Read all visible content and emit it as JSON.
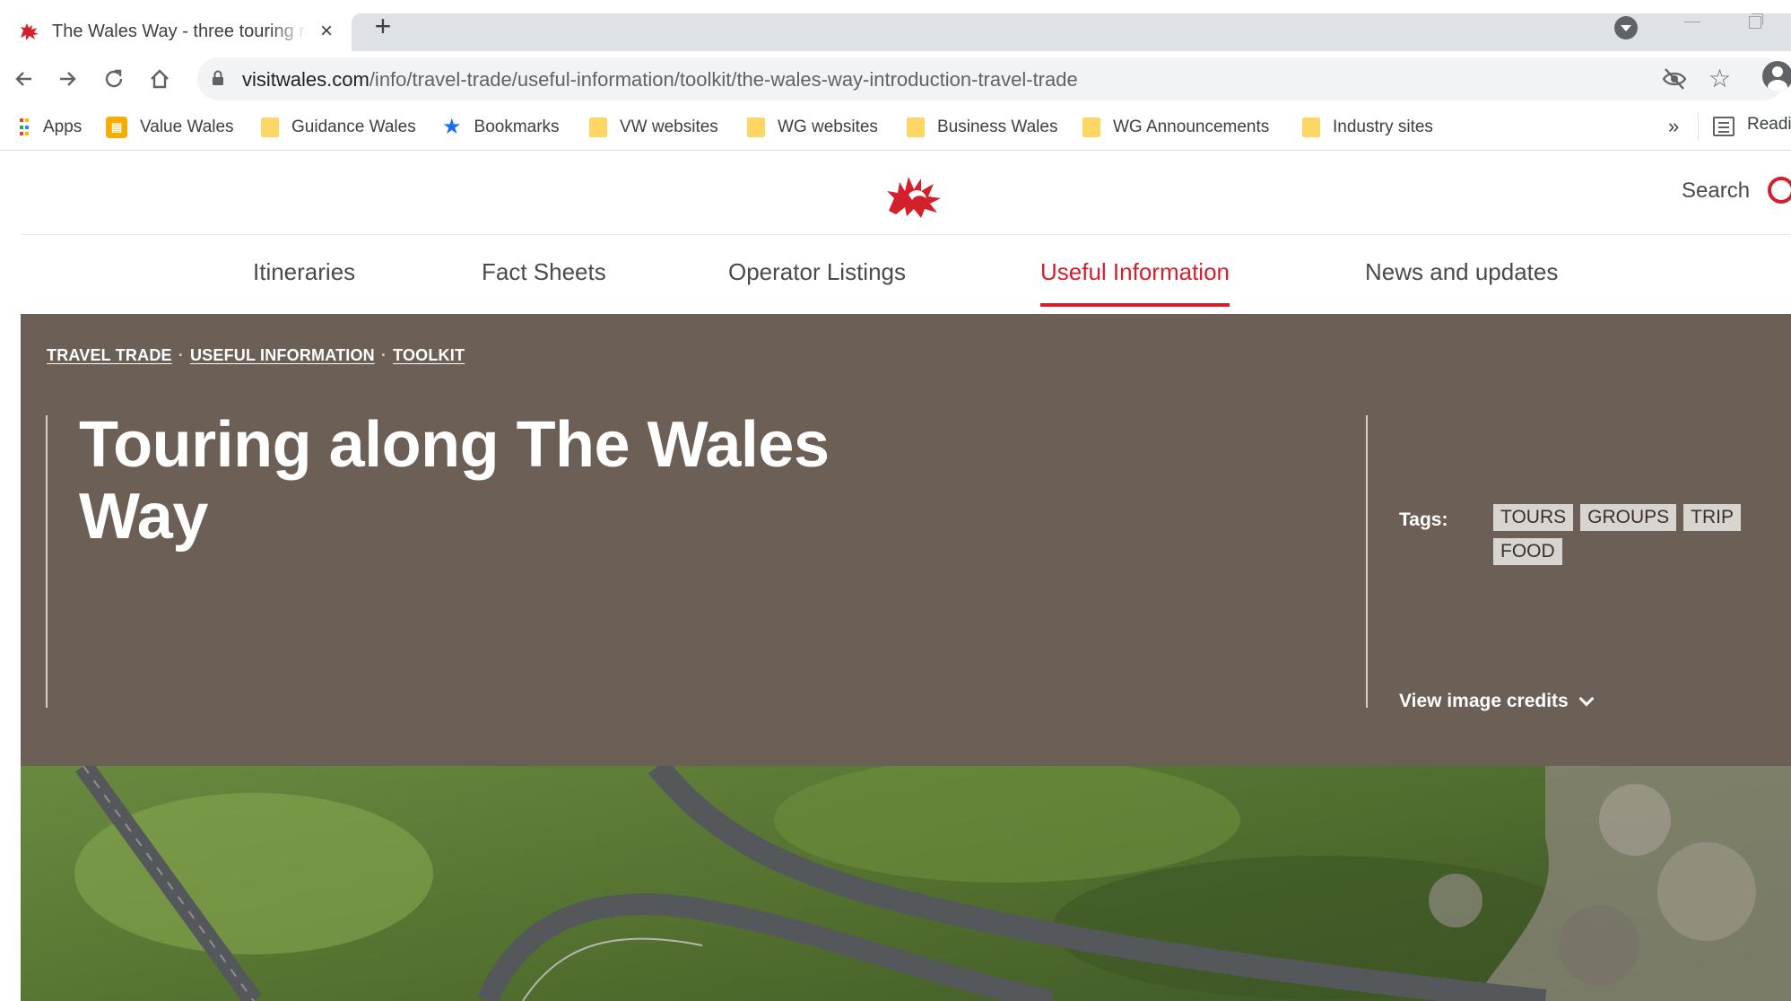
{
  "browser": {
    "tab": {
      "title": "The Wales Way - three touring routes",
      "close": "×"
    },
    "new_tab": "+",
    "url": {
      "host": "visitwales.com",
      "path": "/info/travel-trade/useful-information/toolkit/the-wales-way-introduction-travel-trade"
    },
    "bookmarks": [
      {
        "label": "Apps",
        "icon": "apps-icon"
      },
      {
        "label": "Value Wales",
        "icon": "value-wales-icon"
      },
      {
        "label": "Guidance Wales",
        "icon": "folder-icon"
      },
      {
        "label": "Bookmarks",
        "icon": "star-icon"
      },
      {
        "label": "VW websites",
        "icon": "folder-icon"
      },
      {
        "label": "WG websites",
        "icon": "folder-icon"
      },
      {
        "label": "Business Wales",
        "icon": "folder-icon"
      },
      {
        "label": "WG Announcements",
        "icon": "folder-icon"
      },
      {
        "label": "Industry sites",
        "icon": "folder-icon"
      }
    ],
    "overflow": "»",
    "reading_list": "Readi"
  },
  "site": {
    "search_label": "Search",
    "nav": [
      {
        "label": "Itineraries"
      },
      {
        "label": "Fact Sheets"
      },
      {
        "label": "Operator Listings"
      },
      {
        "label": "Useful Information",
        "active": true
      },
      {
        "label": "News and updates"
      }
    ],
    "breadcrumb": [
      "TRAVEL TRADE",
      "USEFUL INFORMATION",
      "TOOLKIT"
    ],
    "title": "Touring along The Wales Way",
    "tags_label": "Tags:",
    "tags": [
      "TOURS",
      "GROUPS",
      "TRIP",
      "FOOD"
    ],
    "image_credits": "View image credits",
    "colors": {
      "accent": "#d4202c",
      "hero_bg": "#6c5f55"
    }
  }
}
